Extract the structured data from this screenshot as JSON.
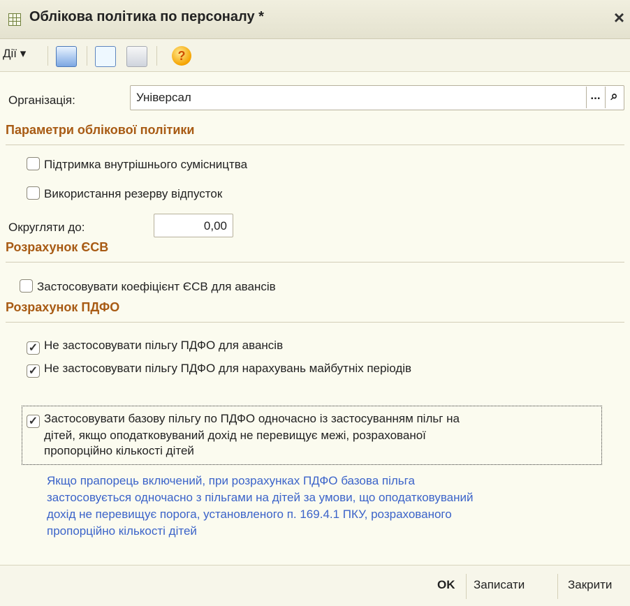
{
  "window": {
    "title": "Облікова політика по персоналу *"
  },
  "toolbar": {
    "actions_label": "Дії ▾"
  },
  "organization": {
    "label": "Організація:",
    "value": "Універсал",
    "dots": "..."
  },
  "sections": {
    "accounting": "Параметри облікової політики",
    "esv": "Розрахунок ЄСВ",
    "pdfo": "Розрахунок ПДФО"
  },
  "checkboxes": {
    "internal_part_time": {
      "label": "Підтримка внутрішнього сумісництва",
      "checked": false
    },
    "vacation_reserve": {
      "label": "Використання резерву відпусток",
      "checked": false
    },
    "esv_coefficient": {
      "label": "Застосовувати коефіцієнт ЄСВ для авансів",
      "checked": false
    },
    "no_benefit_advances": {
      "label": "Не застосовувати пільгу ПДФО для авансів",
      "checked": true
    },
    "no_benefit_future": {
      "label": "Не застосовувати пільгу ПДФО для нарахувань майбутніх періодів",
      "checked": true
    },
    "base_benefit": {
      "line1": "Застосовувати базову пільгу по ПДФО одночасно із застосуванням пільг на",
      "line2": "дітей, якщо оподатковуваний дохід не перевищує межі, розрахованої",
      "line3": "пропорційно кількості дітей",
      "checked": true
    }
  },
  "rounding": {
    "label": "Округляти до:",
    "value": "0,00"
  },
  "help_text": {
    "line1": "Якщо прапорець включений, при розрахунках ПДФО базова пільга",
    "line2": "застосовується одночасно з пільгами на дітей за умови, що оподатковуваний",
    "line3": "дохід не перевищує порога, установленого п. 169.4.1 ПКУ, розрахованого",
    "line4": "пропорційно кількості дітей"
  },
  "footer": {
    "ok": "OK",
    "save": "Записати",
    "close": "Закрити"
  },
  "colors": {
    "section": "#a85b14",
    "help": "#3b63c9",
    "background": "#fbfbef"
  },
  "icons": [
    "table-icon",
    "close-icon",
    "export-icon",
    "refresh-icon",
    "document-icon",
    "help-icon",
    "search-icon"
  ]
}
